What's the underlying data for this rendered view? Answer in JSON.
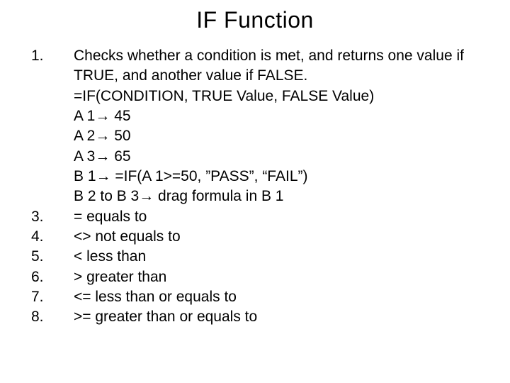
{
  "title": "IF Function",
  "items": [
    {
      "num": "1.",
      "lines": [
        "Checks whether a condition is met, and returns one value if TRUE, and another value if FALSE.",
        "=IF(CONDITION, TRUE Value, FALSE Value)",
        "A 1→ 45",
        "A 2→ 50",
        "A 3→ 65",
        "B 1→ =IF(A 1>=50, ”PASS”, “FAIL”)",
        "B 2 to B 3→ drag formula in B 1"
      ]
    },
    {
      "num": "3.",
      "lines": [
        "= equals to"
      ]
    },
    {
      "num": "4.",
      "lines": [
        "<> not equals to"
      ]
    },
    {
      "num": "5.",
      "lines": [
        "< less than"
      ]
    },
    {
      "num": "6.",
      "lines": [
        "> greater than"
      ]
    },
    {
      "num": "7.",
      "lines": [
        "<= less than or equals to"
      ]
    },
    {
      "num": "8.",
      "lines": [
        ">= greater than or equals to"
      ]
    }
  ]
}
